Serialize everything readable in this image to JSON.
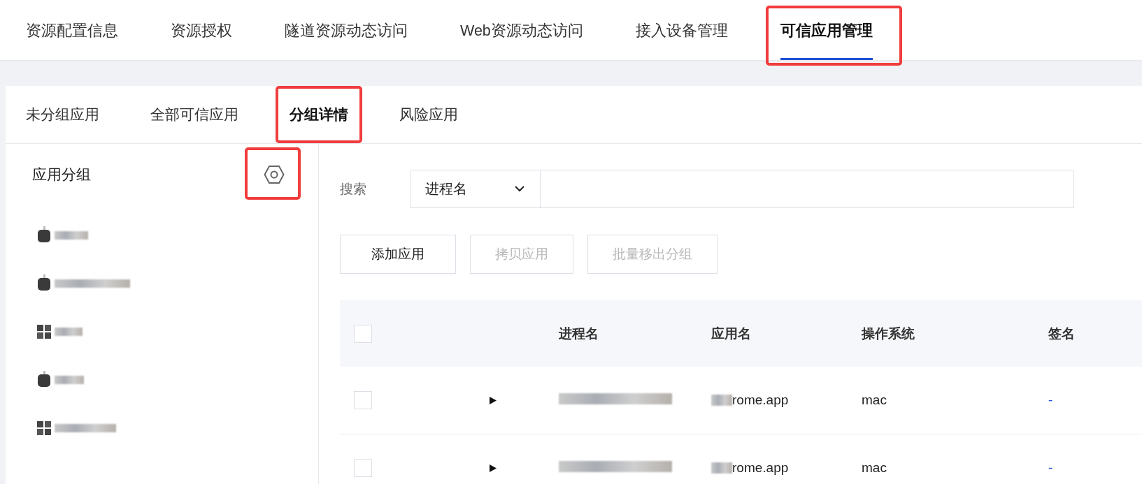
{
  "top_tabs": [
    {
      "label": "资源配置信息",
      "selected": false,
      "highlighted": false
    },
    {
      "label": "资源授权",
      "selected": false,
      "highlighted": false
    },
    {
      "label": "隧道资源动态访问",
      "selected": false,
      "highlighted": false
    },
    {
      "label": "Web资源动态访问",
      "selected": false,
      "highlighted": false
    },
    {
      "label": "接入设备管理",
      "selected": false,
      "highlighted": false
    },
    {
      "label": "可信应用管理",
      "selected": true,
      "highlighted": true
    }
  ],
  "sub_tabs": [
    {
      "label": "未分组应用",
      "selected": false,
      "highlighted": false
    },
    {
      "label": "全部可信应用",
      "selected": false,
      "highlighted": false
    },
    {
      "label": "分组详情",
      "selected": true,
      "highlighted": true
    },
    {
      "label": "风险应用",
      "selected": false,
      "highlighted": false
    }
  ],
  "sidebar": {
    "title": "应用分组",
    "settings_highlighted": true,
    "groups": [
      {
        "kind": "mac"
      },
      {
        "kind": "mac"
      },
      {
        "kind": "windows"
      },
      {
        "kind": "mac"
      },
      {
        "kind": "windows"
      }
    ]
  },
  "search": {
    "label": "搜索",
    "field": "进程名"
  },
  "buttons": [
    {
      "label": "添加应用",
      "disabled": false
    },
    {
      "label": "拷贝应用",
      "disabled": true
    },
    {
      "label": "批量移出分组",
      "disabled": true
    }
  ],
  "table": {
    "columns": [
      "进程名",
      "应用名",
      "操作系统",
      "签名"
    ],
    "header_checked": false,
    "rows": [
      {
        "checked": false,
        "expanded": false,
        "app_name": "rome.app",
        "os": "mac",
        "signature": "-"
      },
      {
        "checked": false,
        "expanded": false,
        "app_name": "rome.app",
        "os": "mac",
        "signature": "-"
      }
    ]
  }
}
